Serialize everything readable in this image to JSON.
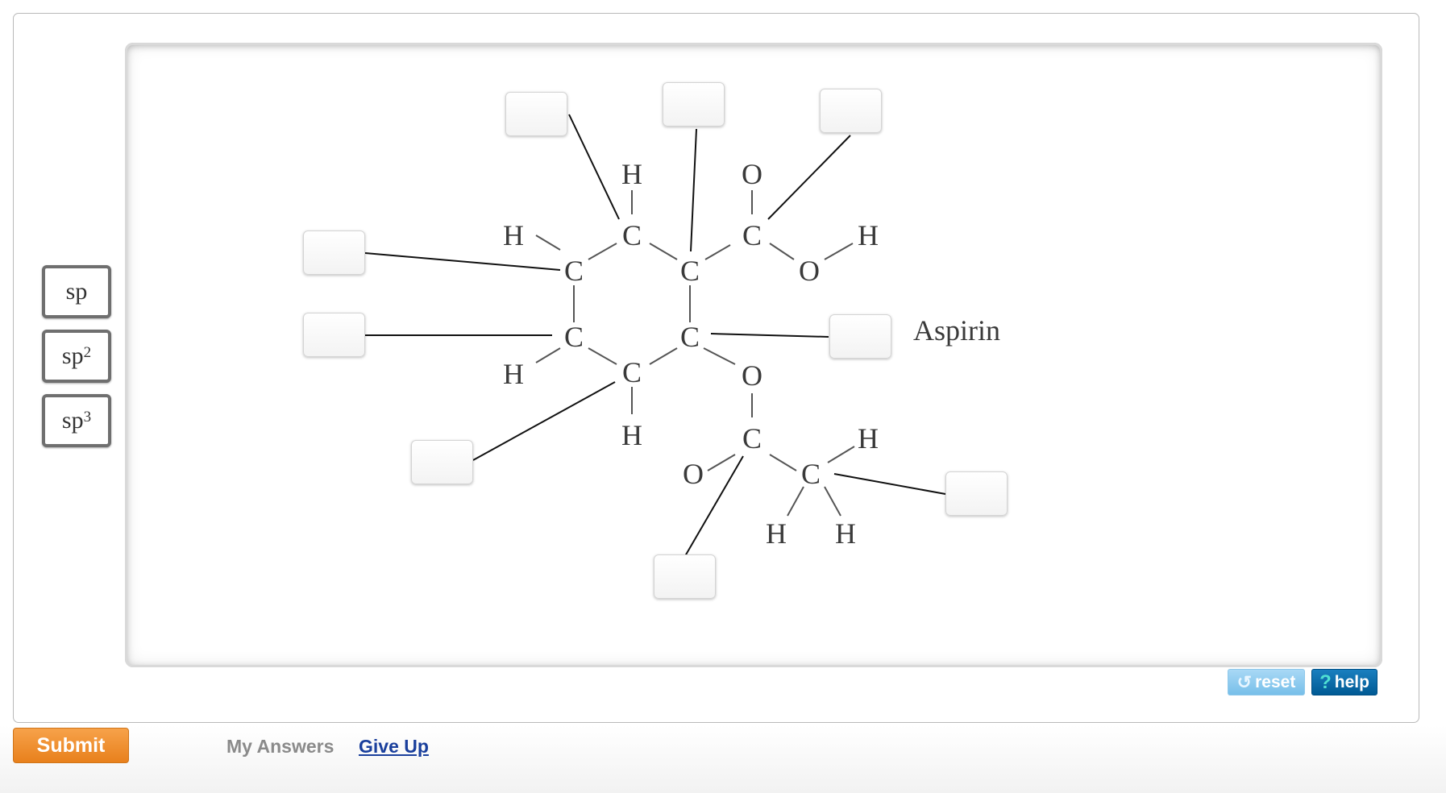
{
  "tiles": [
    {
      "base": "sp",
      "sup": ""
    },
    {
      "base": "sp",
      "sup": "2"
    },
    {
      "base": "sp",
      "sup": "3"
    }
  ],
  "diagram": {
    "caption": "Aspirin",
    "atoms": {
      "c_top": "C",
      "h_top": "H",
      "c_upper_left": "C",
      "h_upper_left": "H",
      "c_upper_right": "C",
      "c_carboxyl": "C",
      "o_carbonyl": "O",
      "o_hydroxyl": "O",
      "h_hydroxyl": "H",
      "c_lower_left": "C",
      "h_lower_left": "H",
      "c_lower_right": "C",
      "c_bottom": "C",
      "h_bottom": "H",
      "o_ester": "O",
      "c_acetyl": "C",
      "o_acetyl": "O",
      "c_methyl": "C",
      "h_methyl_1": "H",
      "h_methyl_2": "H",
      "h_methyl_3": "H"
    }
  },
  "buttons": {
    "reset": "reset",
    "help": "help",
    "submit": "Submit",
    "my_answers": "My Answers",
    "give_up": "Give Up"
  },
  "icons": {
    "reset": "reset-icon",
    "help": "help-icon"
  },
  "colors": {
    "submit": "#e8801c",
    "help": "#005a94",
    "reset": "#77bfe9",
    "link": "#1a3f9c"
  }
}
